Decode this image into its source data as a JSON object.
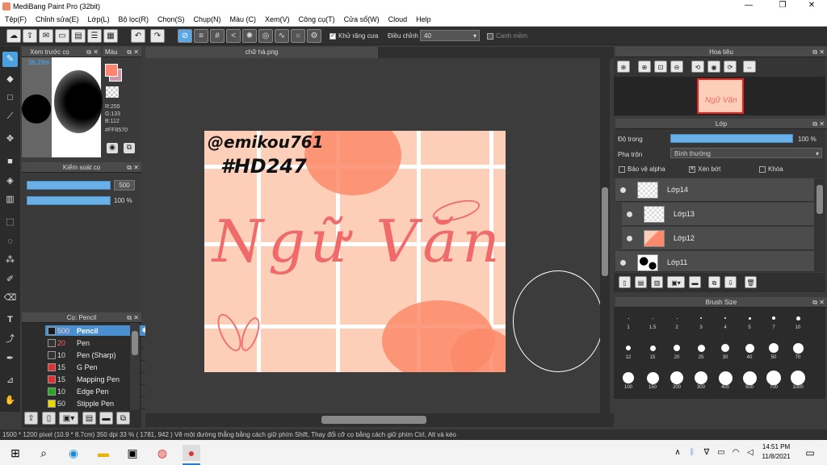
{
  "window": {
    "title": "MediBang Paint Pro (32bit)",
    "min": "—",
    "max": "❐",
    "close": "✕"
  },
  "menu": [
    "Tệp(F)",
    "Chỉnh sửa(E)",
    "Lớp(L)",
    "Bộ lọc(R)",
    "Chọn(S)",
    "Chụp(N)",
    "Màu (C)",
    "Xem(V)",
    "Công cụ(T)",
    "Cửa sổ(W)",
    "Cloud",
    "Help"
  ],
  "toolbar": {
    "antialias": "Khử răng cưa",
    "adjust": "Điều chỉnh",
    "adjust_value": "40",
    "smooth": "Canh mềm"
  },
  "panels": {
    "preview": {
      "title": "Xem trước cọ",
      "zoom": "36.29m"
    },
    "color": {
      "title": "Màu",
      "r": "R:255",
      "g": "G:133",
      "b": "B:112",
      "hex": "#FF8570",
      "fg": "#ff8570",
      "bg": "#ffffff"
    },
    "brush_control": {
      "title": "Kiểm soát cọ",
      "size": "500",
      "opacity": "100 %"
    },
    "brush_list": {
      "title": "Cọ: Pencil",
      "items": [
        {
          "size": "500",
          "name": "Pencil",
          "color": "#000000"
        },
        {
          "size": "20",
          "name": "Pen",
          "color": "#333333"
        },
        {
          "size": "10",
          "name": "Pen (Sharp)",
          "color": "#333333"
        },
        {
          "size": "15",
          "name": "G Pen",
          "color": "#e03030"
        },
        {
          "size": "15",
          "name": "Mapping Pen",
          "color": "#e03030"
        },
        {
          "size": "10",
          "name": "Edge Pen",
          "color": "#22aa22"
        },
        {
          "size": "50",
          "name": "Stipple Pen",
          "color": "#e8d800"
        }
      ]
    },
    "navigator": {
      "title": "Hoa tiêu"
    },
    "layers": {
      "title": "Lớp",
      "opacity_label": "Độ trong",
      "opacity_value": "100 %",
      "blend_label": "Pha trộn",
      "blend_value": "Bình thường",
      "protect_alpha": "Bảo vệ alpha",
      "clipping": "Xén bớt",
      "lock": "Khóa",
      "items": [
        "Lớp14",
        "Lớp13",
        "Lớp12",
        "Lớp11"
      ]
    },
    "brush_size": {
      "title": "Brush Size",
      "sizes": [
        "1",
        "1.5",
        "2",
        "3",
        "4",
        "5",
        "7",
        "10",
        "12",
        "15",
        "20",
        "25",
        "30",
        "40",
        "50",
        "70",
        "100",
        "150",
        "200",
        "300",
        "400",
        "500",
        "700",
        "1000"
      ]
    }
  },
  "document": {
    "tab": "chữ hà.png",
    "text1": "@emikou761",
    "text2": "#HD247",
    "text3": "Ngữ Văn"
  },
  "status": "1500 * 1200 pixel   (10.9 * 8.7cm)   350 dpi   33 %   ( 1781, 942 )   Vẽ một đường thẳng bằng cách giữ phím Shift, Thay đổi cỡ cọ bằng cách giữ phím Ctrl, Alt và kéo",
  "taskbar": {
    "time": "14:51 PM",
    "date": "11/8/2021"
  }
}
